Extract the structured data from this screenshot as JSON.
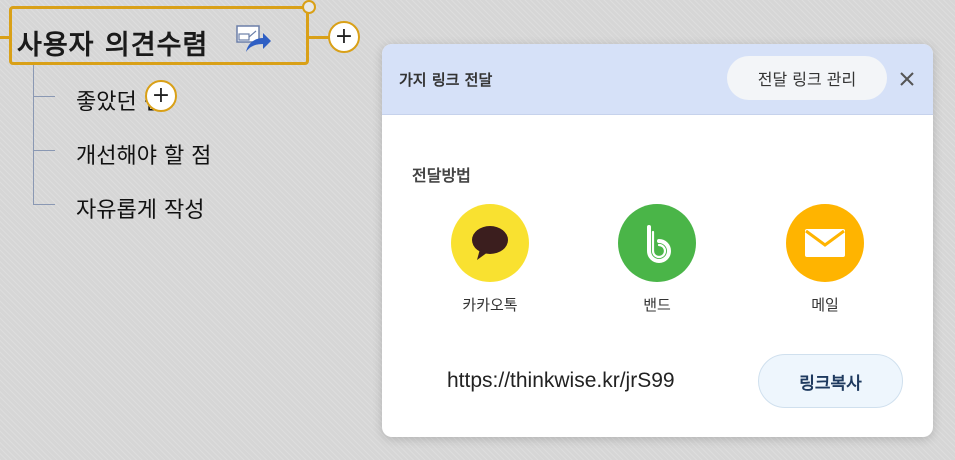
{
  "mindmap": {
    "root_label": "사용자 의견수렴",
    "children": [
      {
        "label": "좋았던 점"
      },
      {
        "label": "개선해야 할 점"
      },
      {
        "label": "자유롭게 작성"
      }
    ],
    "add_symbol": "+"
  },
  "share_panel": {
    "title": "가지 링크 전달",
    "manage_button": "전달 링크 관리",
    "method_heading": "전달방법",
    "methods": [
      {
        "label": "카카오톡",
        "icon": "kakaotalk-icon",
        "color": "#f9e130"
      },
      {
        "label": "밴드",
        "icon": "band-icon",
        "color": "#4ab548"
      },
      {
        "label": "메일",
        "icon": "mail-icon",
        "color": "#ffb400"
      }
    ],
    "link_url": "https://thinkwise.kr/jrS99",
    "copy_button": "링크복사",
    "header_color": "#d6e1f8"
  }
}
